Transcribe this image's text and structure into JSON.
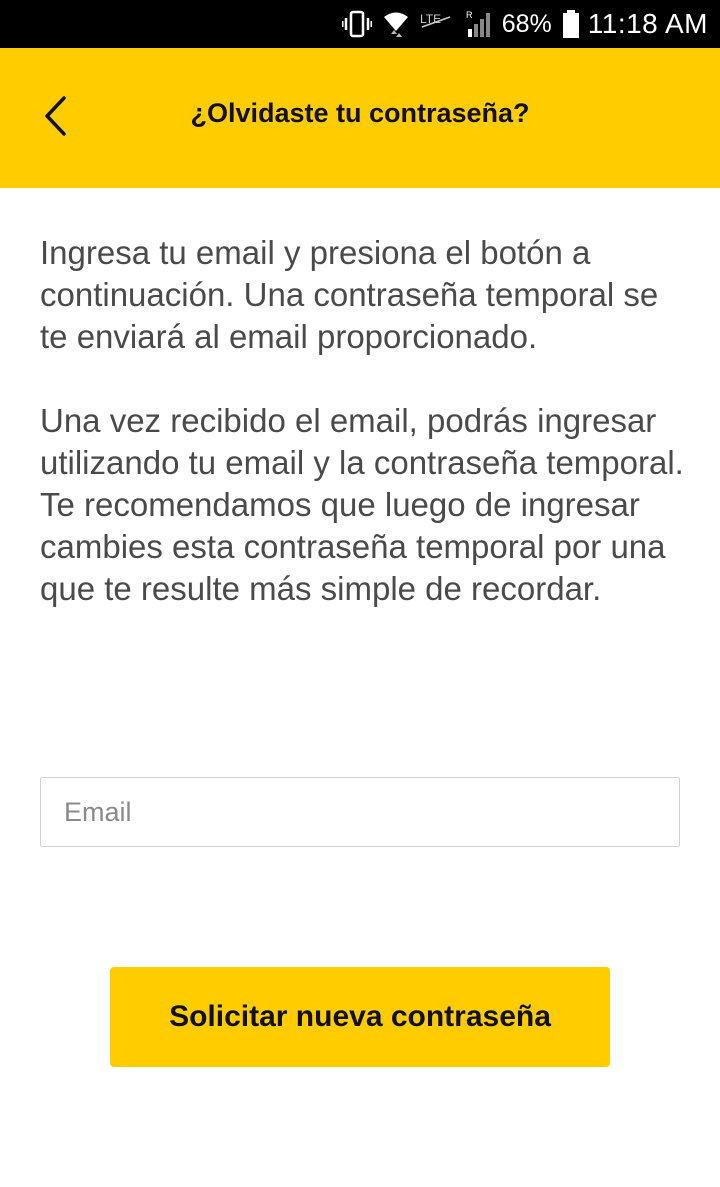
{
  "status_bar": {
    "battery_percent": "68%",
    "time": "11:18 AM",
    "icons": [
      "vibrate-icon",
      "wifi-icon",
      "lte-icon",
      "signal-icon",
      "battery-icon"
    ]
  },
  "app_bar": {
    "title": "¿Olvidaste tu contraseña?",
    "back_icon": "chevron-left-icon"
  },
  "content": {
    "paragraph_1": "Ingresa tu email y presiona el botón a continuación. Una contraseña temporal se te enviará al email proporcionado.",
    "paragraph_2_line_1": "Una vez recibido el email, podrás ingresar utilizando tu email y la contraseña temporal.",
    "paragraph_2_line_2": "Te recomendamos que luego de ingresar cambies esta contraseña temporal por una que te resulte más simple de recordar."
  },
  "form": {
    "email_placeholder": "Email",
    "email_value": "",
    "submit_label": "Solicitar nueva contraseña"
  },
  "colors": {
    "accent": "#FFCC00",
    "status_bar": "#000000",
    "body_text": "#4a4a4a"
  }
}
